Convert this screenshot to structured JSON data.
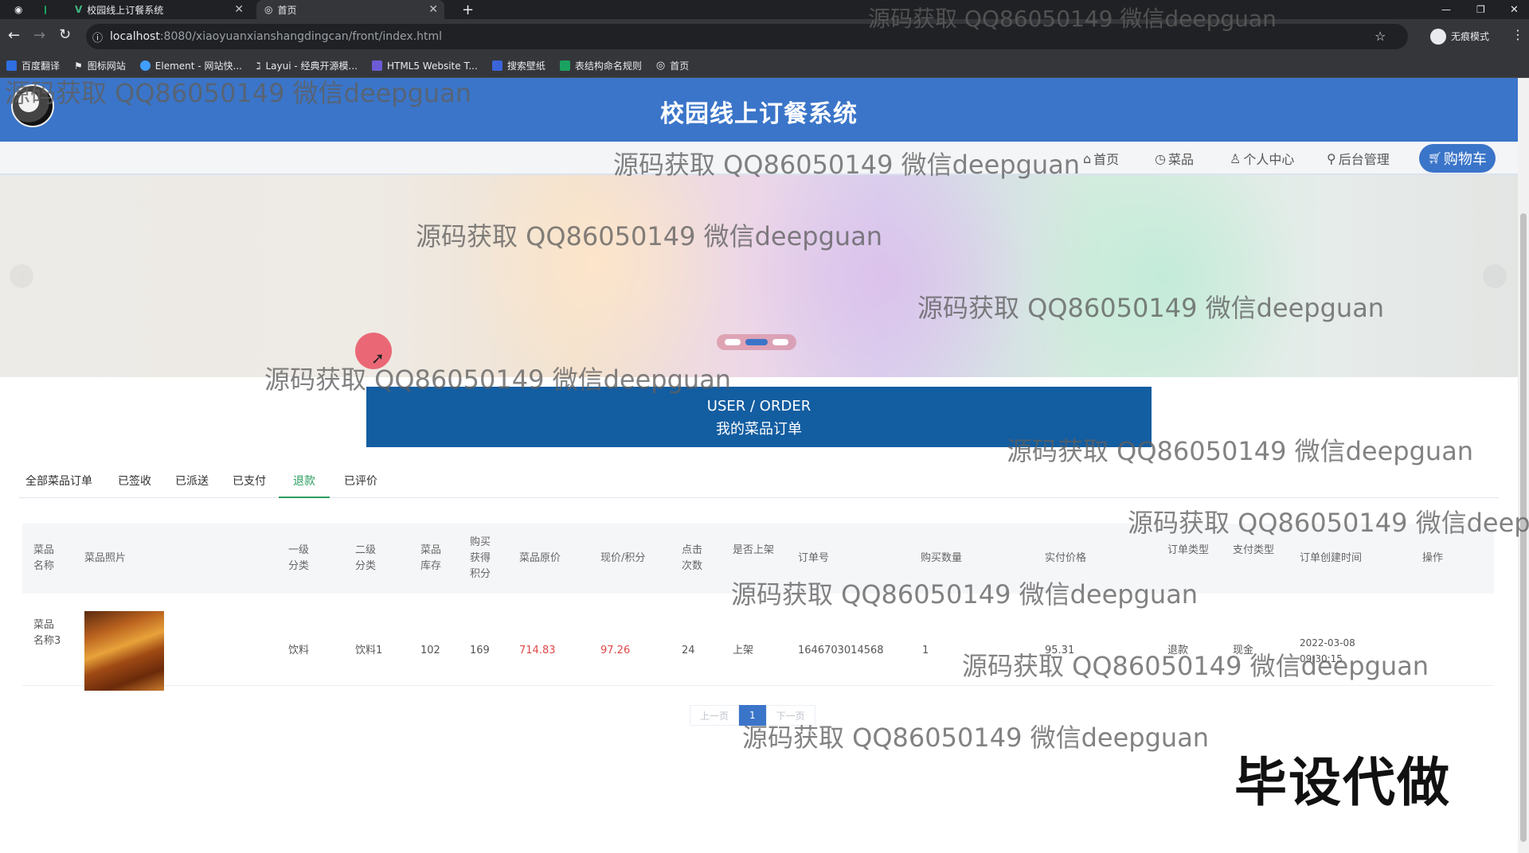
{
  "browser": {
    "tabs": [
      {
        "label": "校园线上订餐系统",
        "active": false
      },
      {
        "label": "首页",
        "active": true
      }
    ],
    "url_host": "localhost",
    "url_path": ":8080/xiaoyuanxianshangdingcan/front/index.html",
    "profile_label": "无痕模式",
    "bookmarks": [
      "百度翻译",
      "图标网站",
      "Element - 网站快...",
      "Layui - 经典开源模...",
      "HTML5 Website T...",
      "搜索壁纸",
      "表结构命名规则",
      "首页"
    ]
  },
  "site": {
    "title": "校园线上订餐系统",
    "nav": [
      "首页",
      "菜品",
      "个人中心",
      "后台管理"
    ],
    "cart_label": "购物车"
  },
  "section": {
    "en": "USER / ORDER",
    "zh": "我的菜品订单"
  },
  "order_tabs": [
    "全部菜品订单",
    "已签收",
    "已派送",
    "已支付",
    "退款",
    "已评价"
  ],
  "active_order_tab": "退款",
  "table": {
    "headers": [
      "菜品名称",
      "菜品照片",
      "一级分类",
      "二级分类",
      "菜品库存",
      "购买获得积分",
      "菜品原价",
      "现价/积分",
      "点击次数",
      "是否上架",
      "订单号",
      "购买数量",
      "实付价格",
      "订单类型",
      "支付类型",
      "订单创建时间",
      "操作"
    ],
    "rows": [
      {
        "name": "菜品名称3",
        "category1": "饮料",
        "category2": "饮料1",
        "stock": "102",
        "points": "169",
        "original_price": "714.83",
        "current_price": "97.26",
        "clicks": "24",
        "on_shelf": "上架",
        "order_no": "1646703014568",
        "quantity": "1",
        "paid": "95.31",
        "order_type": "退款",
        "pay_type": "现金",
        "created": "2022-03-08 09:30:15"
      }
    ]
  },
  "pager": {
    "prev": "上一页",
    "current": "1",
    "next": "下一页"
  },
  "watermark": "源码获取 QQ86050149 微信deepguan",
  "corner_mark": "毕设代做"
}
